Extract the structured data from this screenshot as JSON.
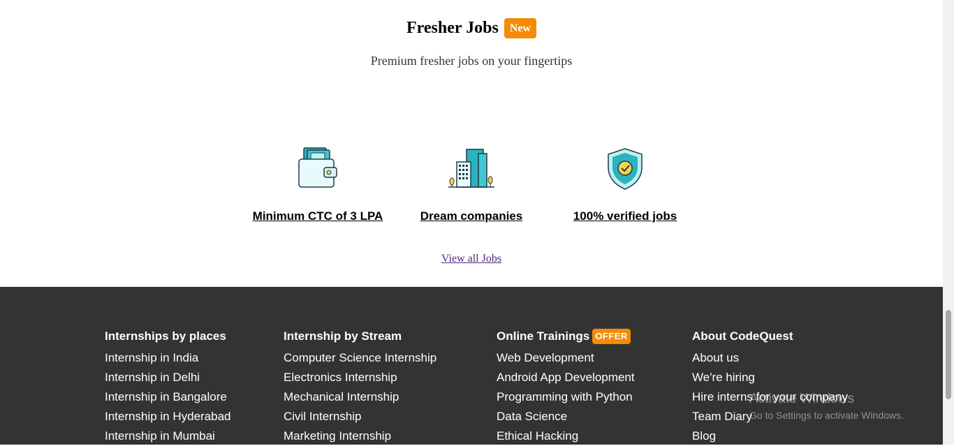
{
  "hero": {
    "title": "Fresher Jobs",
    "badge": "New",
    "subtitle": "Premium fresher jobs on your fingertips",
    "features": [
      {
        "icon": "wallet-icon",
        "label": "Minimum CTC of 3 LPA"
      },
      {
        "icon": "office-building-icon",
        "label": "Dream companies"
      },
      {
        "icon": "verified-shield-icon",
        "label": "100% verified jobs"
      }
    ],
    "view_all": "View all Jobs"
  },
  "footer": {
    "columns": [
      {
        "heading": "Internships by places",
        "items": [
          "Internship in India",
          "Internship in Delhi",
          "Internship in Bangalore",
          "Internship in Hyderabad",
          "Internship in Mumbai"
        ]
      },
      {
        "heading": "Internship by Stream",
        "items": [
          "Computer Science Internship",
          "Electronics Internship",
          "Mechanical Internship",
          "Civil Internship",
          "Marketing Internship"
        ]
      },
      {
        "heading": "Online Trainings",
        "badge": "OFFER",
        "items": [
          "Web Development",
          "Android App Development",
          "Programming with Python",
          "Data Science",
          "Ethical Hacking"
        ]
      },
      {
        "heading": "About CodeQuest",
        "items": [
          "About us",
          "We're hiring",
          "Hire interns for your company",
          "Team Diary",
          "Blog"
        ]
      }
    ]
  },
  "watermark": {
    "title": "Activate Windows",
    "subtitle": "Go to Settings to activate Windows."
  },
  "colors": {
    "accent": "#f58b06",
    "footer_bg": "#333333",
    "icon_teal": "#2bb3c0"
  }
}
